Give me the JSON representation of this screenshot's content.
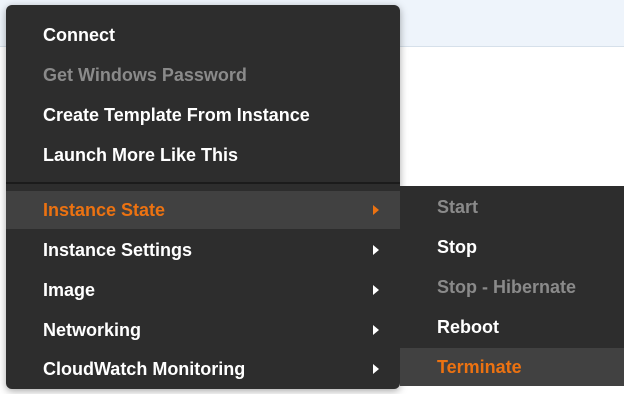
{
  "context_menu": {
    "items": [
      {
        "label": "Connect",
        "state": "enabled"
      },
      {
        "label": "Get Windows Password",
        "state": "disabled"
      },
      {
        "label": "Create Template From Instance",
        "state": "enabled"
      },
      {
        "label": "Launch More Like This",
        "state": "enabled"
      },
      {
        "label": "Instance State",
        "state": "active",
        "has_submenu": true
      },
      {
        "label": "Instance Settings",
        "state": "enabled",
        "has_submenu": true
      },
      {
        "label": "Image",
        "state": "enabled",
        "has_submenu": true
      },
      {
        "label": "Networking",
        "state": "enabled",
        "has_submenu": true
      },
      {
        "label": "CloudWatch Monitoring",
        "state": "enabled",
        "has_submenu": true
      }
    ]
  },
  "instance_state_submenu": {
    "items": [
      {
        "label": "Start",
        "state": "disabled"
      },
      {
        "label": "Stop",
        "state": "enabled"
      },
      {
        "label": "Stop - Hibernate",
        "state": "disabled"
      },
      {
        "label": "Reboot",
        "state": "enabled"
      },
      {
        "label": "Terminate",
        "state": "active"
      }
    ]
  },
  "colors": {
    "menu_background": "#2d2d2d",
    "highlight_background": "#414141",
    "accent": "#ec7211",
    "text": "#ffffff",
    "disabled_text": "#8a8a8a"
  },
  "icons": {
    "submenu_indicator": "chevron-right-icon"
  }
}
